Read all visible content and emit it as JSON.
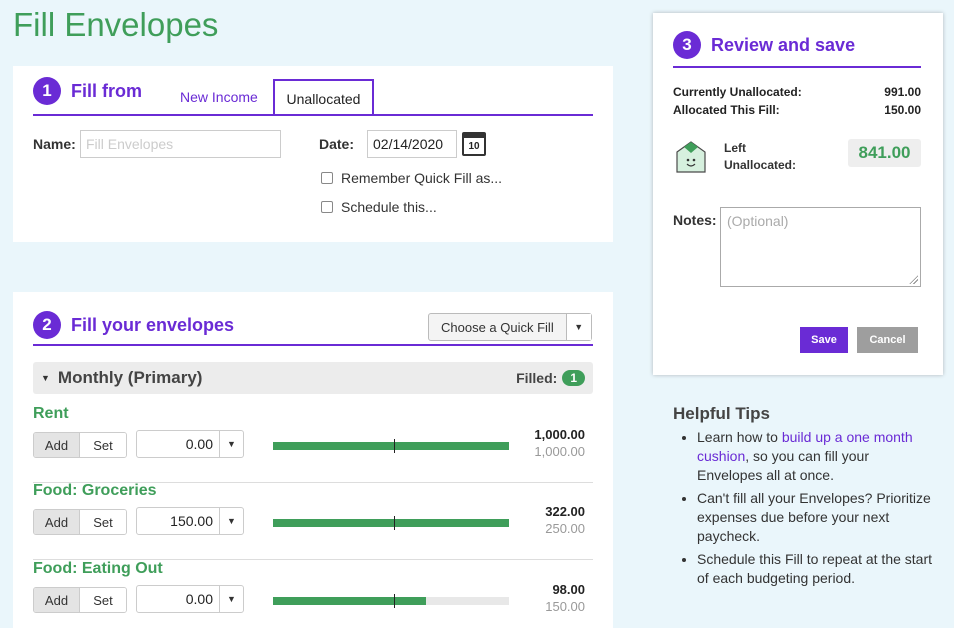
{
  "page_title": "Fill Envelopes",
  "colors": {
    "accent": "#6a2bd5",
    "green": "#3f9e5a"
  },
  "fill_from": {
    "step": "1",
    "title": "Fill from",
    "tabs": [
      "New Income",
      "Unallocated"
    ],
    "active_tab": "Unallocated",
    "name_label": "Name:",
    "name_placeholder": "Fill Envelopes",
    "date_label": "Date:",
    "date_value": "02/14/2020",
    "calendar_day": "10",
    "remember_label": "Remember Quick Fill as...",
    "schedule_label": "Schedule this..."
  },
  "fill_envelopes": {
    "step": "2",
    "title": "Fill your envelopes",
    "quick_fill_label": "Choose a Quick Fill",
    "group": {
      "name": "Monthly (Primary)",
      "filled_label": "Filled:",
      "filled_count": "1"
    },
    "add_label": "Add",
    "set_label": "Set",
    "envelopes": [
      {
        "name": "Rent",
        "fill_amount": "0.00",
        "total": "1,000.00",
        "budget": "1,000.00",
        "bar_fraction": 1.0
      },
      {
        "name": "Food: Groceries",
        "fill_amount": "150.00",
        "total": "322.00",
        "budget": "250.00",
        "bar_fraction": 1.0
      },
      {
        "name": "Food: Eating Out",
        "fill_amount": "0.00",
        "total": "98.00",
        "budget": "150.00",
        "bar_fraction": 0.65
      }
    ]
  },
  "review": {
    "step": "3",
    "title": "Review and save",
    "currently_unallocated_label": "Currently Unallocated:",
    "currently_unallocated_value": "991.00",
    "allocated_label": "Allocated This Fill:",
    "allocated_value": "150.00",
    "left_label_1": "Left",
    "left_label_2": "Unallocated:",
    "left_value": "841.00",
    "notes_label": "Notes:",
    "notes_placeholder": "(Optional)",
    "save_label": "Save",
    "cancel_label": "Cancel"
  },
  "tips": {
    "title": "Helpful Tips",
    "tip1_pre": "Learn how to ",
    "tip1_link": "build up a one month cushion",
    "tip1_post": ", so you can fill your Envelopes all at once.",
    "tip2": "Can't fill all your Envelopes? Prioritize expenses due before your next paycheck.",
    "tip3": "Schedule this Fill to repeat at the start of each budgeting period."
  }
}
